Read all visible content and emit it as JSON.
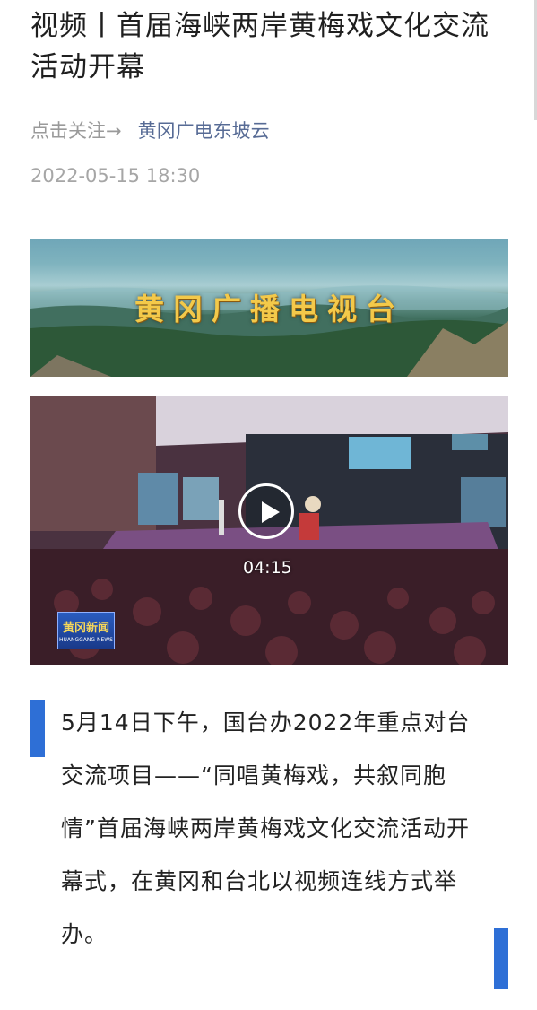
{
  "article": {
    "title": "视频丨首届海峡两岸黄梅戏文化交流活动开幕",
    "follow_prompt": "点击关注→",
    "account_name": "黄冈广电东坡云",
    "publish_time": "2022-05-15 18:30"
  },
  "banner": {
    "text": "黄冈广播电视台"
  },
  "video": {
    "duration": "04:15",
    "logo_text": "黄冈新闻",
    "logo_subtext": "HUANGGANG NEWS"
  },
  "body": {
    "paragraph": "5月14日下午，国台办2022年重点对台交流项目——“同唱黄梅戏，共叙同胞情”首届海峡两岸黄梅戏文化交流活动开幕式，在黄冈和台北以视频连线方式举办。"
  },
  "colors": {
    "accent": "#2e6fd6",
    "account_link": "#576b95",
    "muted": "#9a9a9a"
  }
}
